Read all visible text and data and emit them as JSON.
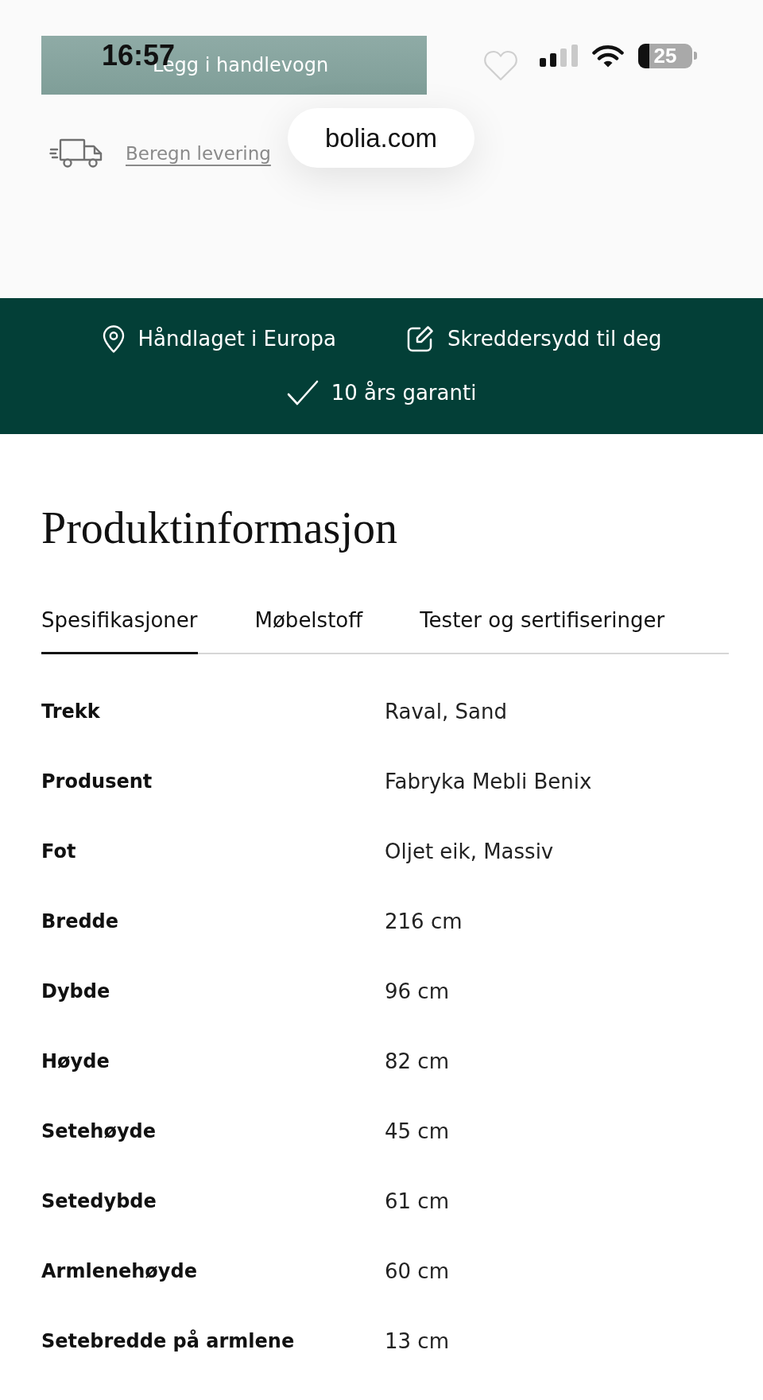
{
  "status_bar": {
    "time": "16:57",
    "battery": "25"
  },
  "product_actions": {
    "add_to_cart": "Legg i handlevogn",
    "delivery_link": "Beregn levering"
  },
  "address_bar": {
    "url": "bolia.com"
  },
  "benefits": [
    {
      "label": "Håndlaget i Europa"
    },
    {
      "label": "Skreddersydd til deg"
    },
    {
      "label": "10 års garanti"
    }
  ],
  "product_info": {
    "title": "Produktinformasjon",
    "tabs": [
      {
        "label": "Spesifikasjoner",
        "selected": true
      },
      {
        "label": "Møbelstoff",
        "selected": false
      },
      {
        "label": "Tester og sertifiseringer",
        "selected": false
      }
    ],
    "specs": [
      {
        "label": "Trekk",
        "value": "Raval, Sand"
      },
      {
        "label": "Produsent",
        "value": "Fabryka Mebli Benix"
      },
      {
        "label": "Fot",
        "value": "Oljet eik, Massiv"
      },
      {
        "label": "Bredde",
        "value": "216 cm"
      },
      {
        "label": "Dybde",
        "value": "96 cm"
      },
      {
        "label": "Høyde",
        "value": "82 cm"
      },
      {
        "label": "Setehøyde",
        "value": "45 cm"
      },
      {
        "label": "Setedybde",
        "value": "61 cm"
      },
      {
        "label": "Armlenehøyde",
        "value": "60 cm"
      },
      {
        "label": "Setebredde på armlene",
        "value": "13 cm"
      }
    ]
  }
}
